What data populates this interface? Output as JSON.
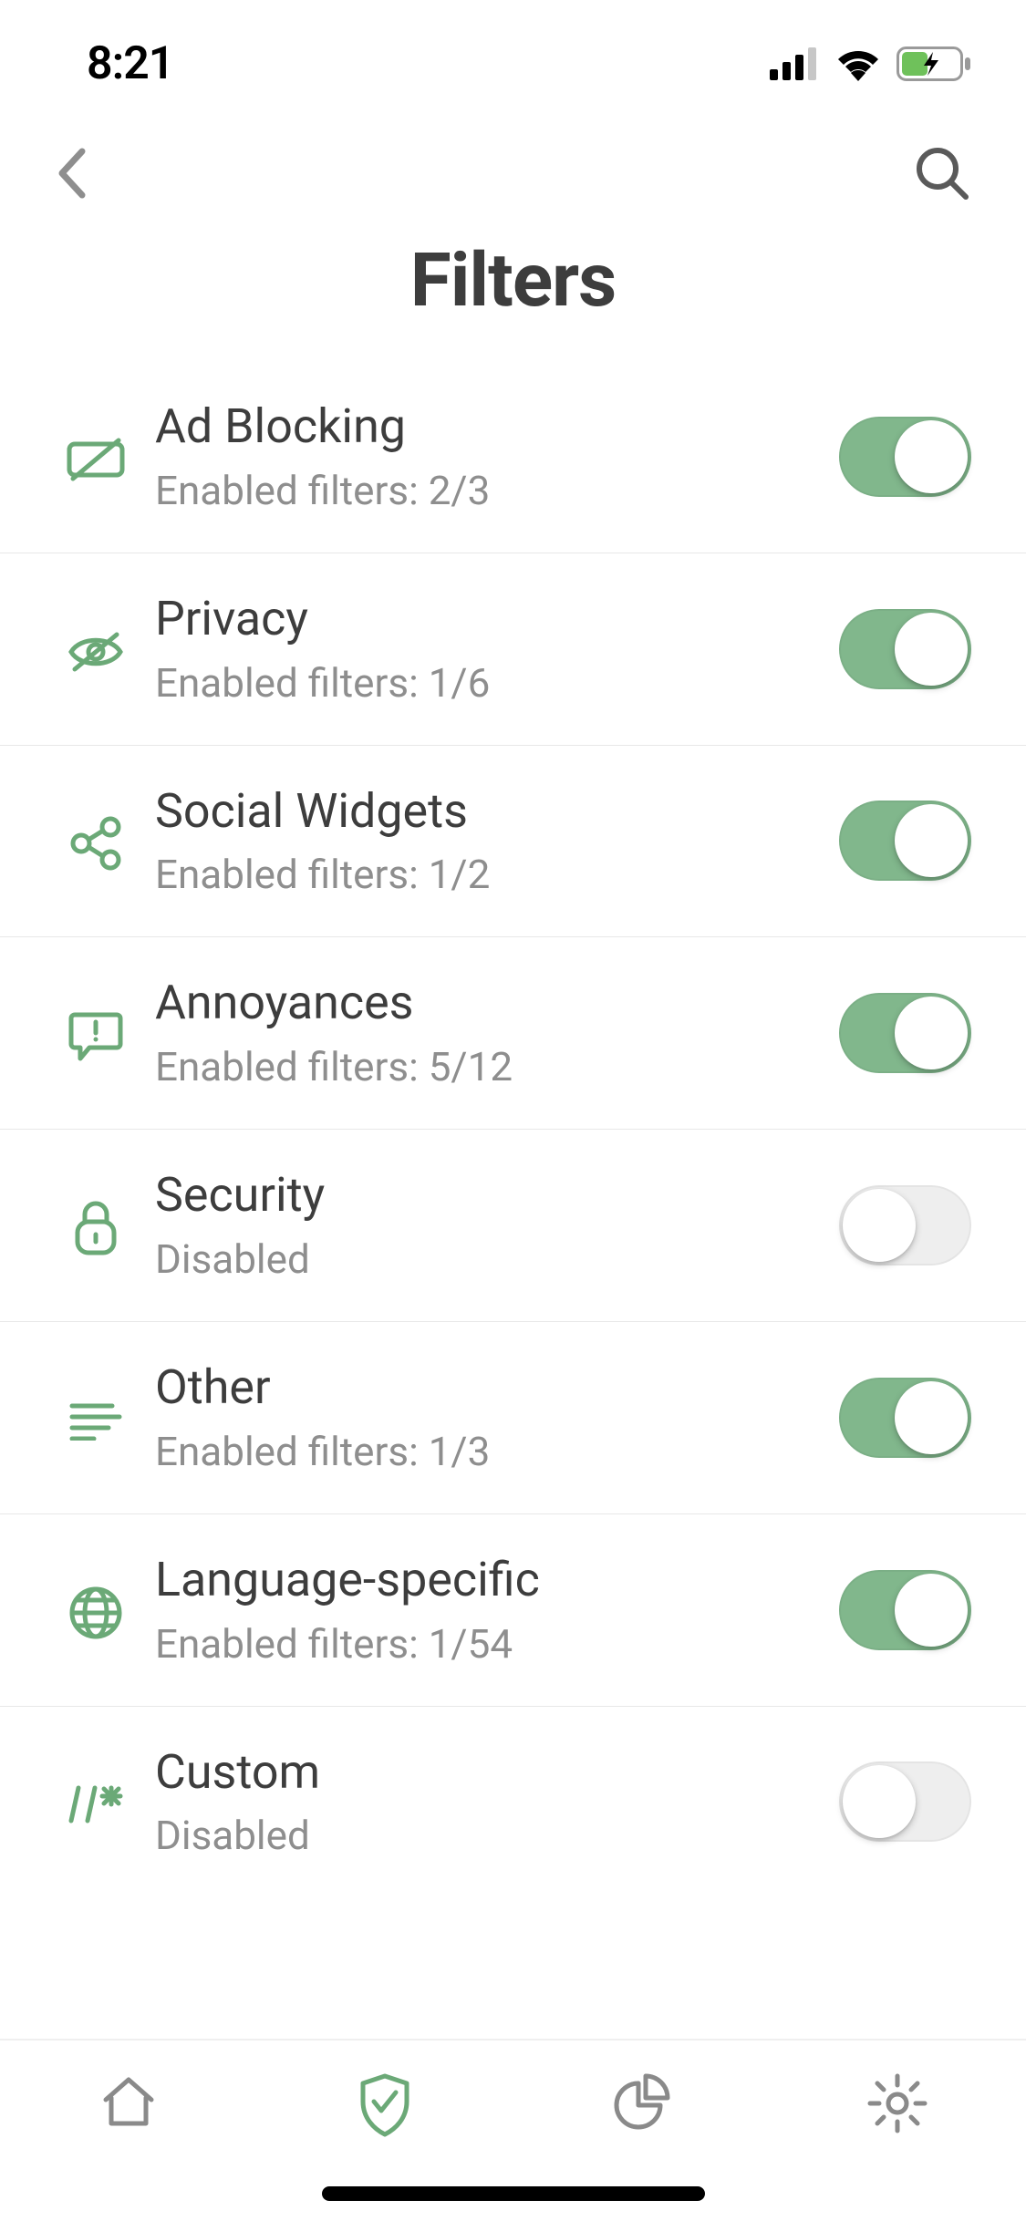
{
  "status": {
    "time": "8:21"
  },
  "title": "Filters",
  "colors": {
    "accent": "#6ba977",
    "muted": "#8e8e8e",
    "text": "#3d3d3d",
    "iconInactive": "#7e7e7e"
  },
  "disabledLabel": "Disabled",
  "rows": [
    {
      "key": "ad-blocking",
      "title": "Ad Blocking",
      "sub": "Enabled filters: 2/3",
      "on": true
    },
    {
      "key": "privacy",
      "title": "Privacy",
      "sub": "Enabled filters: 1/6",
      "on": true
    },
    {
      "key": "social",
      "title": "Social Widgets",
      "sub": "Enabled filters: 1/2",
      "on": true
    },
    {
      "key": "annoyances",
      "title": "Annoyances",
      "sub": "Enabled filters: 5/12",
      "on": true
    },
    {
      "key": "security",
      "title": "Security",
      "sub": "Disabled",
      "on": false
    },
    {
      "key": "other",
      "title": "Other",
      "sub": "Enabled filters: 1/3",
      "on": true
    },
    {
      "key": "language",
      "title": "Language-specific",
      "sub": "Enabled filters: 1/54",
      "on": true
    },
    {
      "key": "custom",
      "title": "Custom",
      "sub": "Disabled",
      "on": false
    }
  ]
}
